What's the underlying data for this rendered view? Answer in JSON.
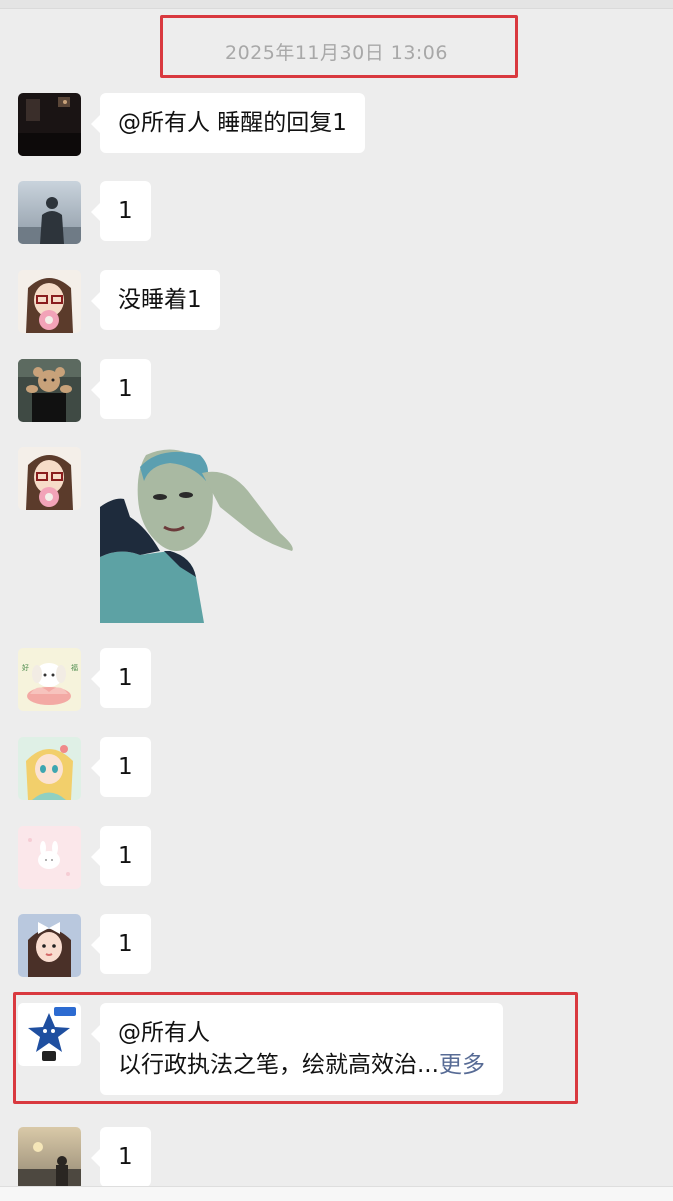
{
  "chat": {
    "timestamp": "2025年11月30日 13:06",
    "messages": [
      {
        "avatar_icon": "dark-room-avatar-icon",
        "text": "@所有人 睡醒的回复1"
      },
      {
        "avatar_icon": "person-silhouette-avatar-icon",
        "text": "1"
      },
      {
        "avatar_icon": "glasses-girl-avatar-icon",
        "text": "没睡着1"
      },
      {
        "avatar_icon": "teddy-bear-avatar-icon",
        "text": "1"
      },
      {
        "avatar_icon": "glasses-girl-avatar-icon",
        "sticker": "dancing-woman-sticker-icon"
      },
      {
        "avatar_icon": "puppy-lotus-avatar-icon",
        "text": "1"
      },
      {
        "avatar_icon": "blonde-anime-girl-avatar-icon",
        "text": "1"
      },
      {
        "avatar_icon": "pink-bunny-avatar-icon",
        "text": "1"
      },
      {
        "avatar_icon": "girl-with-bow-avatar-icon",
        "text": "1"
      },
      {
        "avatar_icon": "blue-star-mascot-avatar-icon",
        "line1": "@所有人",
        "line2": "以行政执法之笔，绘就高效治...",
        "more": "更多"
      },
      {
        "avatar_icon": "sunset-avatar-icon",
        "text": "1"
      }
    ]
  },
  "colors": {
    "background": "#ededed",
    "bubble": "#ffffff",
    "highlight_box": "#d9393f",
    "more_link": "#576b95",
    "timestamp_text": "#a8a8a8"
  }
}
